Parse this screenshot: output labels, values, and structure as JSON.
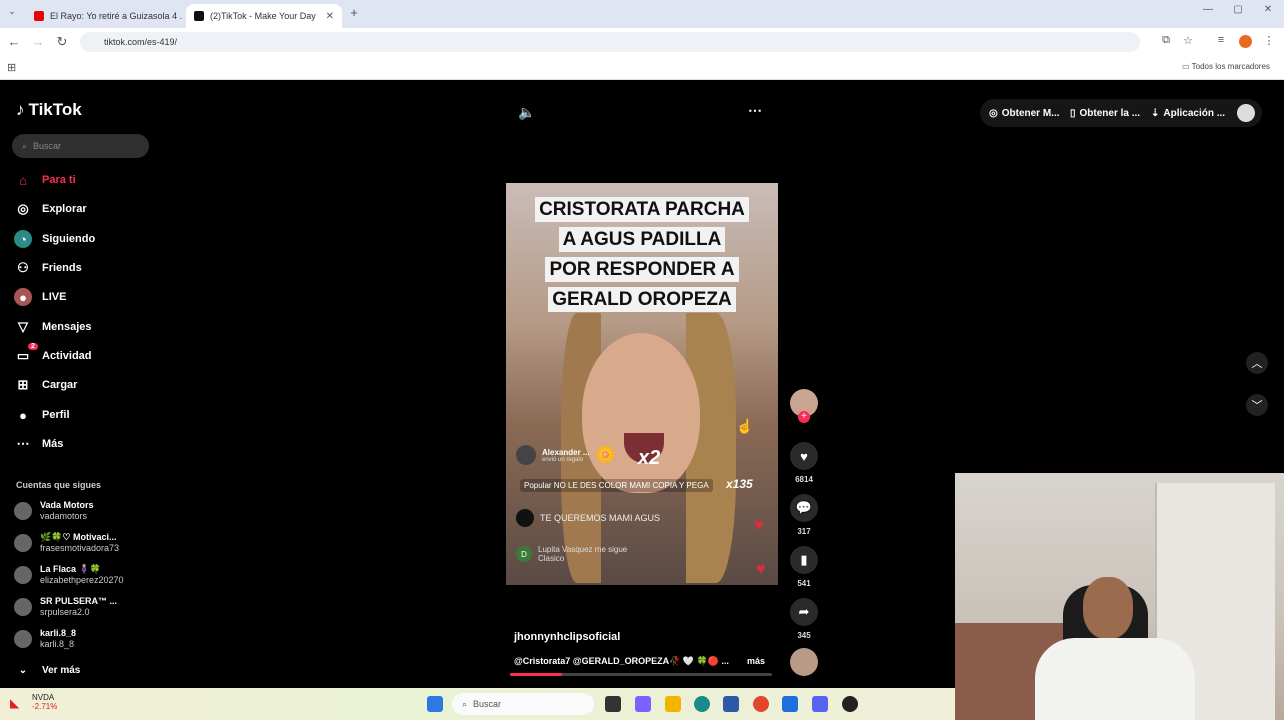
{
  "browser": {
    "tabs": [
      {
        "title": "El Rayo: Yo retiré a Guizasola 4 ...",
        "active": false
      },
      {
        "title": "(2)TikTok - Make Your Day",
        "active": true
      }
    ],
    "new_tab": "+",
    "url": "tiktok.com/es-419/",
    "bookmarks_label": "Todos los marcadores"
  },
  "tiktok": {
    "logo": "TikTok",
    "search_placeholder": "Buscar",
    "nav": [
      {
        "label": "Para ti",
        "icon": "home-icon",
        "active": true
      },
      {
        "label": "Explorar",
        "icon": "compass-icon"
      },
      {
        "label": "Siguiendo",
        "icon": "following-icon"
      },
      {
        "label": "Friends",
        "icon": "friends-icon"
      },
      {
        "label": "LIVE",
        "icon": "live-icon"
      },
      {
        "label": "Mensajes",
        "icon": "messages-icon"
      },
      {
        "label": "Actividad",
        "icon": "activity-icon",
        "badge": "2"
      },
      {
        "label": "Cargar",
        "icon": "upload-icon"
      },
      {
        "label": "Perfil",
        "icon": "profile-icon"
      },
      {
        "label": "Más",
        "icon": "more-icon"
      }
    ],
    "following_title": "Cuentas que sigues",
    "following": [
      {
        "name": "Vada Motors",
        "user": "vadamotors"
      },
      {
        "name": "🌿🍀♡ Motivaci...",
        "user": "frasesmotivadora73"
      },
      {
        "name": "La Flaca 🧍🏼‍♀️🍀",
        "user": "elizabethperez20270"
      },
      {
        "name": "SR PULSERA™ ...",
        "user": "srpulsera2.0"
      },
      {
        "name": "karli.8_8",
        "user": "karli.8_8"
      }
    ],
    "see_more": "Ver más",
    "top_actions": [
      "Obtener M...",
      "Obtener la ...",
      "Aplicación ..."
    ],
    "video": {
      "caption_lines": [
        "CRISTORATA PARCHA",
        "A AGUS PADILLA",
        "POR RESPONDER A",
        "GERALD OROPEZA"
      ],
      "gift_user": "Alexander ...",
      "gift_sub": "envió un regalo",
      "gift_mult": "x2",
      "popular_text": "Popular NO LE DES COLOR MAMI COPIA Y PEGA",
      "combo": "x135",
      "comment1": "TE QUEREMOS MAMI AGUS",
      "comment2_user": "D",
      "comment2_a": "Lupita Vasquez me sigue",
      "comment2_b": "Clasico",
      "author": "jhonnynhclipsoficial",
      "description": "@Cristorata7 @GERALD_OROPEZA🥀 🤍 🍀🔴 ...",
      "more": "más",
      "progress_fraction": 0.2
    },
    "actions": [
      {
        "icon": "heart-icon",
        "count": "6814"
      },
      {
        "icon": "comment-icon",
        "count": "317"
      },
      {
        "icon": "bookmark-icon",
        "count": "541"
      },
      {
        "icon": "share-icon",
        "count": "345"
      }
    ]
  },
  "taskbar": {
    "weather_label": "NVDA",
    "weather_value": "-2.71%",
    "search": "Buscar"
  },
  "colors": {
    "accent": "#fe2c55",
    "page_bg": "#000000"
  }
}
